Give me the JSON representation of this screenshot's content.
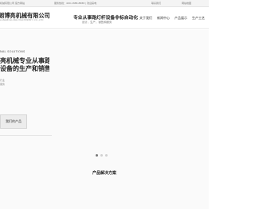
{
  "topbar": {
    "company_text": "机械有限公司 官方网站",
    "contact_text": "服务热线：400-1888-8888 | 欢迎来电",
    "links": [
      "联系我们",
      "网站地图"
    ]
  },
  "header": {
    "logo_name": "朗博亮机械有限公司",
    "logo_sub": "LANGBOLIANG MACHINERY CO.,LTD",
    "slogan_main": "专业从事路灯杆设备非标自动化",
    "slogan_sub": "设计，生产，销售和服务"
  },
  "nav": {
    "items": [
      "关于我们",
      "新闻中心",
      "产品展示",
      "生产工艺"
    ]
  },
  "hero": {
    "kicker": "NAL SOLUTIONS",
    "title_lines": [
      "亮机械专业从事路",
      "设备的生产和销售"
    ],
    "meta_lines": [
      "行业",
      "服务"
    ],
    "button_label": "我们的产品"
  },
  "section": {
    "title": "产品解决方案"
  }
}
